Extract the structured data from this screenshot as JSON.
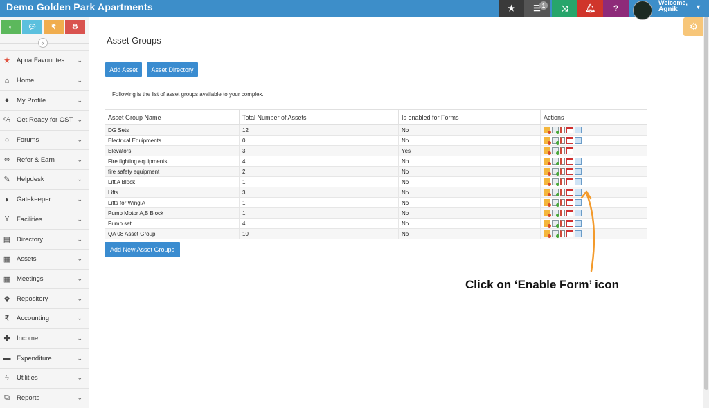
{
  "app": {
    "title": "Demo Golden Park Apartments"
  },
  "topbar": {
    "list_badge": "1",
    "welcome": "Welcome,",
    "user": "Agnik"
  },
  "quick_buttons": [
    "dashboard",
    "chat",
    "₹",
    "settings"
  ],
  "sidebar": {
    "items": [
      {
        "label": "Apna Favourites",
        "icon": "star-icon"
      },
      {
        "label": "Home",
        "icon": "home-icon"
      },
      {
        "label": "My Profile",
        "icon": "user-icon"
      },
      {
        "label": "Get Ready for GST",
        "icon": "percent-icon"
      },
      {
        "label": "Forums",
        "icon": "comments-icon"
      },
      {
        "label": "Refer & Earn",
        "icon": "handshake-icon"
      },
      {
        "label": "Helpdesk",
        "icon": "wrench-icon"
      },
      {
        "label": "Gatekeeper",
        "icon": "shield-icon"
      },
      {
        "label": "Facilities",
        "icon": "cocktail-icon"
      },
      {
        "label": "Directory",
        "icon": "directory-icon"
      },
      {
        "label": "Assets",
        "icon": "assets-icon"
      },
      {
        "label": "Meetings",
        "icon": "calendar-icon"
      },
      {
        "label": "Repository",
        "icon": "dropbox-icon"
      },
      {
        "label": "Accounting",
        "icon": "rupee-icon"
      },
      {
        "label": "Income",
        "icon": "plus-icon"
      },
      {
        "label": "Expenditure",
        "icon": "minus-icon"
      },
      {
        "label": "Utilities",
        "icon": "bolt-icon"
      },
      {
        "label": "Reports",
        "icon": "copy-icon"
      }
    ]
  },
  "main": {
    "page_title": "Asset Groups",
    "add_asset": "Add Asset",
    "asset_directory": "Asset Directory",
    "intro": "Following is the list of asset groups available to your complex.",
    "add_new_groups": "Add New Asset Groups",
    "table": {
      "headers": [
        "Asset Group Name",
        "Total Number of Assets",
        "Is enabled for Forms",
        "Actions"
      ],
      "rows": [
        {
          "name": "DG Sets",
          "total": "12",
          "forms": "No",
          "form_icon": true
        },
        {
          "name": "Electrical Equipments",
          "total": "0",
          "forms": "No",
          "form_icon": true
        },
        {
          "name": "Elevators",
          "total": "3",
          "forms": "Yes",
          "form_icon": false
        },
        {
          "name": "Fire fighting equipments",
          "total": "4",
          "forms": "No",
          "form_icon": true
        },
        {
          "name": "fire safety equipment",
          "total": "2",
          "forms": "No",
          "form_icon": true
        },
        {
          "name": "Lift A Block",
          "total": "1",
          "forms": "No",
          "form_icon": true
        },
        {
          "name": "Lifts",
          "total": "3",
          "forms": "No",
          "form_icon": true
        },
        {
          "name": "Lifts for Wing A",
          "total": "1",
          "forms": "No",
          "form_icon": true
        },
        {
          "name": "Pump Motor A,B Block",
          "total": "1",
          "forms": "No",
          "form_icon": true
        },
        {
          "name": "Pump set",
          "total": "4",
          "forms": "No",
          "form_icon": true
        },
        {
          "name": "QA 08 Asset Group",
          "total": "10",
          "forms": "No",
          "form_icon": true
        }
      ]
    }
  },
  "annotation": {
    "text": "Click on ‘Enable Form’ icon",
    "color": "#f39a2b"
  }
}
